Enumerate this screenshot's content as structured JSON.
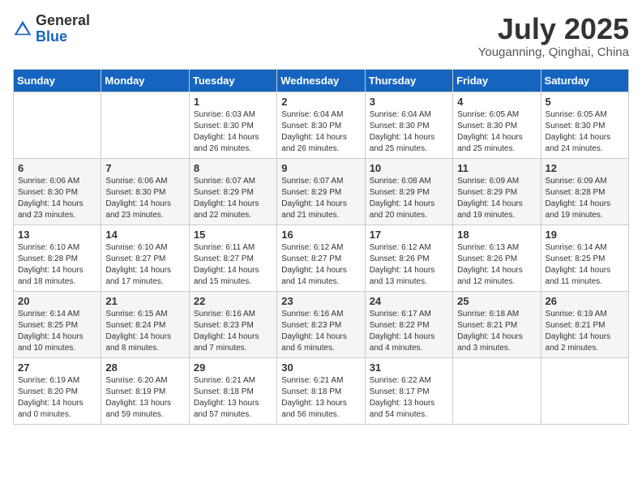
{
  "header": {
    "logo_line1": "General",
    "logo_line2": "Blue",
    "month": "July 2025",
    "location": "Youganning, Qinghai, China"
  },
  "days_of_week": [
    "Sunday",
    "Monday",
    "Tuesday",
    "Wednesday",
    "Thursday",
    "Friday",
    "Saturday"
  ],
  "weeks": [
    [
      {
        "day": "",
        "info": ""
      },
      {
        "day": "",
        "info": ""
      },
      {
        "day": "1",
        "info": "Sunrise: 6:03 AM\nSunset: 8:30 PM\nDaylight: 14 hours and 26 minutes."
      },
      {
        "day": "2",
        "info": "Sunrise: 6:04 AM\nSunset: 8:30 PM\nDaylight: 14 hours and 26 minutes."
      },
      {
        "day": "3",
        "info": "Sunrise: 6:04 AM\nSunset: 8:30 PM\nDaylight: 14 hours and 25 minutes."
      },
      {
        "day": "4",
        "info": "Sunrise: 6:05 AM\nSunset: 8:30 PM\nDaylight: 14 hours and 25 minutes."
      },
      {
        "day": "5",
        "info": "Sunrise: 6:05 AM\nSunset: 8:30 PM\nDaylight: 14 hours and 24 minutes."
      }
    ],
    [
      {
        "day": "6",
        "info": "Sunrise: 6:06 AM\nSunset: 8:30 PM\nDaylight: 14 hours and 23 minutes."
      },
      {
        "day": "7",
        "info": "Sunrise: 6:06 AM\nSunset: 8:30 PM\nDaylight: 14 hours and 23 minutes."
      },
      {
        "day": "8",
        "info": "Sunrise: 6:07 AM\nSunset: 8:29 PM\nDaylight: 14 hours and 22 minutes."
      },
      {
        "day": "9",
        "info": "Sunrise: 6:07 AM\nSunset: 8:29 PM\nDaylight: 14 hours and 21 minutes."
      },
      {
        "day": "10",
        "info": "Sunrise: 6:08 AM\nSunset: 8:29 PM\nDaylight: 14 hours and 20 minutes."
      },
      {
        "day": "11",
        "info": "Sunrise: 6:09 AM\nSunset: 8:29 PM\nDaylight: 14 hours and 19 minutes."
      },
      {
        "day": "12",
        "info": "Sunrise: 6:09 AM\nSunset: 8:28 PM\nDaylight: 14 hours and 19 minutes."
      }
    ],
    [
      {
        "day": "13",
        "info": "Sunrise: 6:10 AM\nSunset: 8:28 PM\nDaylight: 14 hours and 18 minutes."
      },
      {
        "day": "14",
        "info": "Sunrise: 6:10 AM\nSunset: 8:27 PM\nDaylight: 14 hours and 17 minutes."
      },
      {
        "day": "15",
        "info": "Sunrise: 6:11 AM\nSunset: 8:27 PM\nDaylight: 14 hours and 15 minutes."
      },
      {
        "day": "16",
        "info": "Sunrise: 6:12 AM\nSunset: 8:27 PM\nDaylight: 14 hours and 14 minutes."
      },
      {
        "day": "17",
        "info": "Sunrise: 6:12 AM\nSunset: 8:26 PM\nDaylight: 14 hours and 13 minutes."
      },
      {
        "day": "18",
        "info": "Sunrise: 6:13 AM\nSunset: 8:26 PM\nDaylight: 14 hours and 12 minutes."
      },
      {
        "day": "19",
        "info": "Sunrise: 6:14 AM\nSunset: 8:25 PM\nDaylight: 14 hours and 11 minutes."
      }
    ],
    [
      {
        "day": "20",
        "info": "Sunrise: 6:14 AM\nSunset: 8:25 PM\nDaylight: 14 hours and 10 minutes."
      },
      {
        "day": "21",
        "info": "Sunrise: 6:15 AM\nSunset: 8:24 PM\nDaylight: 14 hours and 8 minutes."
      },
      {
        "day": "22",
        "info": "Sunrise: 6:16 AM\nSunset: 8:23 PM\nDaylight: 14 hours and 7 minutes."
      },
      {
        "day": "23",
        "info": "Sunrise: 6:16 AM\nSunset: 8:23 PM\nDaylight: 14 hours and 6 minutes."
      },
      {
        "day": "24",
        "info": "Sunrise: 6:17 AM\nSunset: 8:22 PM\nDaylight: 14 hours and 4 minutes."
      },
      {
        "day": "25",
        "info": "Sunrise: 6:18 AM\nSunset: 8:21 PM\nDaylight: 14 hours and 3 minutes."
      },
      {
        "day": "26",
        "info": "Sunrise: 6:19 AM\nSunset: 8:21 PM\nDaylight: 14 hours and 2 minutes."
      }
    ],
    [
      {
        "day": "27",
        "info": "Sunrise: 6:19 AM\nSunset: 8:20 PM\nDaylight: 14 hours and 0 minutes."
      },
      {
        "day": "28",
        "info": "Sunrise: 6:20 AM\nSunset: 8:19 PM\nDaylight: 13 hours and 59 minutes."
      },
      {
        "day": "29",
        "info": "Sunrise: 6:21 AM\nSunset: 8:18 PM\nDaylight: 13 hours and 57 minutes."
      },
      {
        "day": "30",
        "info": "Sunrise: 6:21 AM\nSunset: 8:18 PM\nDaylight: 13 hours and 56 minutes."
      },
      {
        "day": "31",
        "info": "Sunrise: 6:22 AM\nSunset: 8:17 PM\nDaylight: 13 hours and 54 minutes."
      },
      {
        "day": "",
        "info": ""
      },
      {
        "day": "",
        "info": ""
      }
    ]
  ]
}
